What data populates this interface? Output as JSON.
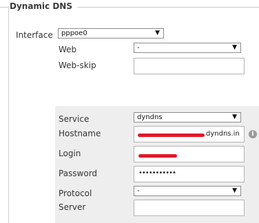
{
  "section": {
    "title": "Dynamic DNS"
  },
  "interface": {
    "label": "Interface",
    "value": "pppoe0"
  },
  "web": {
    "label": "Web",
    "value": "-"
  },
  "web_skip": {
    "label": "Web-skip",
    "value": ""
  },
  "service": {
    "label": "Service",
    "value": "dyndns"
  },
  "hostname": {
    "label": "Hostname",
    "visible_suffix": "dyndns.in"
  },
  "login": {
    "label": "Login",
    "value": ""
  },
  "password": {
    "label": "Password",
    "value": "•••••••••••"
  },
  "protocol": {
    "label": "Protocol",
    "value": "-"
  },
  "server": {
    "label": "Server",
    "value": ""
  },
  "icons": {
    "info": "info-icon",
    "dropdown": "chevron-down-icon"
  },
  "colors": {
    "redaction": "#e0192a",
    "panel_bg": "#eeeeee",
    "legend_line": "#c8c8c8"
  }
}
